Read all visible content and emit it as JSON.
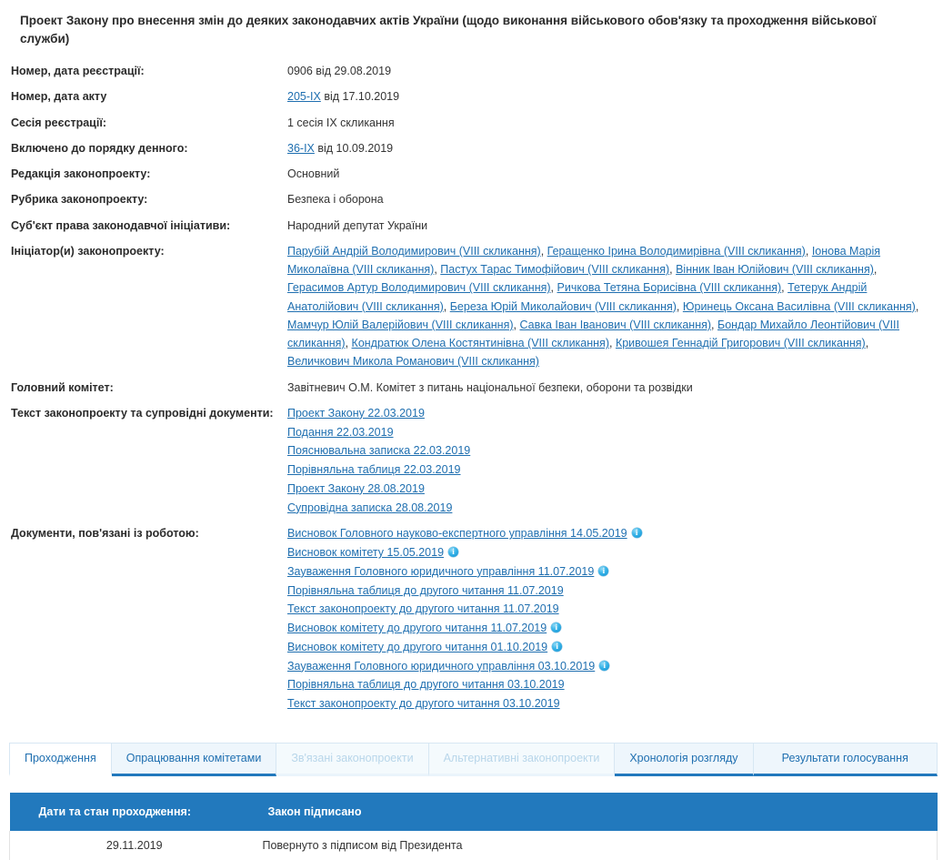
{
  "title": "Проект Закону про внесення змін до деяких законодавчих актів України (щодо виконання військового обов'язку та проходження військової служби)",
  "fields": {
    "reg_number_label": "Номер, дата реєстрації:",
    "reg_number_value": "0906 від 29.08.2019",
    "act_number_label": "Номер, дата акту",
    "act_number_link": "205-IX",
    "act_number_rest": "від 17.10.2019",
    "session_label": "Сесія реєстрації:",
    "session_value": "1 сесія IX скликання",
    "agenda_label": "Включено до порядку денного:",
    "agenda_link": "36-IX",
    "agenda_rest": "від 10.09.2019",
    "edition_label": "Редакція законопроекту:",
    "edition_value": "Основний",
    "rubric_label": "Рубрика законопроекту:",
    "rubric_value": "Безпека і оборона",
    "subject_label": "Суб'єкт права законодавчої ініціативи:",
    "subject_value": "Народний депутат України",
    "initiators_label": "Ініціатор(и) законопроекту:",
    "committee_label": "Головний комітет:",
    "committee_value": "Завітневич О.М. Комітет з питань національної безпеки, оборони та розвідки",
    "text_docs_label": "Текст законопроекту та супровідні документи:",
    "related_docs_label": "Документи, пов'язані із роботою:"
  },
  "initiators": [
    "Парубій Андрій Володимирович (VIII скликання)",
    "Геращенко Ірина Володимирівна (VIII скликання)",
    "Іонова Марія Миколаївна (VIII скликання)",
    "Пастух Тарас Тимофійович (VIII скликання)",
    "Вінник Іван Юлійович (VIII скликання)",
    "Герасимов Артур Володимирович (VIII скликання)",
    "Ричкова Тетяна Борисівна (VIII скликання)",
    "Тетерук Андрій Анатолійович (VIII скликання)",
    "Береза Юрій Миколайович (VIII скликання)",
    "Юринець Оксана Василівна (VIII скликання)",
    "Мамчур Юлій Валерійович (VIII скликання)",
    "Савка Іван Іванович (VIII скликання)",
    "Бондар Михайло Леонтійович (VIII скликання)",
    "Кондратюк Олена Костянтинівна (VIII скликання)",
    "Кривошея Геннадій Григорович (VIII скликання)",
    "Величкович Микола Романович (VIII скликання)"
  ],
  "text_documents": [
    "Проект Закону 22.03.2019",
    "Подання 22.03.2019",
    "Пояснювальна записка 22.03.2019",
    "Порівняльна таблиця 22.03.2019",
    "Проект Закону 28.08.2019",
    "Супровідна записка 28.08.2019"
  ],
  "related_documents": [
    {
      "label": "Висновок Головного науково-експертного управління 14.05.2019",
      "info": true
    },
    {
      "label": "Висновок комітету 15.05.2019",
      "info": true
    },
    {
      "label": "Зауваження Головного юридичного управління 11.07.2019",
      "info": true
    },
    {
      "label": "Порівняльна таблиця до другого читання 11.07.2019",
      "info": false
    },
    {
      "label": "Текст законопроекту до другого читання 11.07.2019",
      "info": false
    },
    {
      "label": "Висновок комітету до другого читання 11.07.2019",
      "info": true
    },
    {
      "label": "Висновок комітету до другого читання 01.10.2019",
      "info": true
    },
    {
      "label": "Зауваження Головного юридичного управління 03.10.2019",
      "info": true
    },
    {
      "label": "Порівняльна таблиця до другого читання 03.10.2019",
      "info": false
    },
    {
      "label": "Текст законопроекту до другого читання 03.10.2019",
      "info": false
    }
  ],
  "tabs": [
    {
      "label": "Проходження",
      "state": "active"
    },
    {
      "label": "Опрацювання комітетами",
      "state": "enabled"
    },
    {
      "label": "Зв'язані законопроекти",
      "state": "disabled"
    },
    {
      "label": "Альтернативні законопроекти",
      "state": "disabled"
    },
    {
      "label": "Хронологія розгляду",
      "state": "enabled"
    },
    {
      "label": "Результати голосування",
      "state": "enabled"
    }
  ],
  "status_table": {
    "header_date": "Дати та стан проходження:",
    "header_state": "Закон підписано",
    "rows": [
      {
        "date": "29.11.2019",
        "state": "Повернуто з підписом від Президента"
      }
    ]
  },
  "colors": {
    "accent_blue": "#2279bd",
    "link_blue": "#1f6fb0",
    "tab_bg": "#eef6fc",
    "tab_disabled_text": "#b8d6ea"
  }
}
